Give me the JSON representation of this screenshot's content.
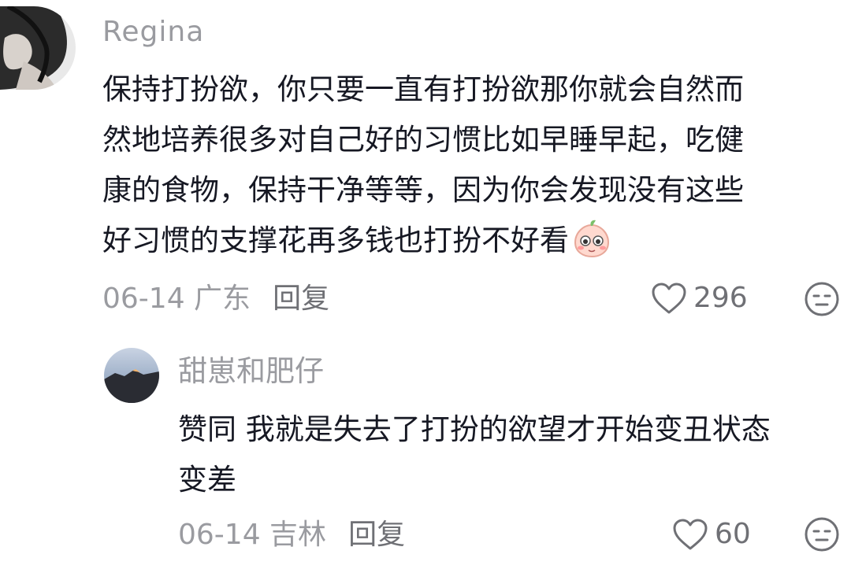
{
  "comments": [
    {
      "username": "Regina",
      "lines": [
        "保持打扮欲，你只要一直有打扮欲那你就会自然而",
        "然地培养很多对自己好的习惯比如早睡早起，吃健",
        "康的食物，保持干净等等，因为你会发现没有这些",
        "好习惯的支撑花再多钱也打扮不好看"
      ],
      "emoji": "peach-face-emoji",
      "date": "06-14 广东",
      "reply_label": "回复",
      "likes": "296"
    },
    {
      "username": "甜崽和肥仔",
      "lines": [
        "赞同 我就是失去了打扮的欲望才开始变丑状态",
        "变差"
      ],
      "date": "06-14 吉林",
      "reply_label": "回复",
      "likes": "60"
    }
  ],
  "icons": {
    "like": "heart-outline-icon",
    "dislike": "neutral-face-icon"
  },
  "colors": {
    "text": "#161823",
    "muted": "#9a9ba0",
    "action": "#6f7075"
  }
}
